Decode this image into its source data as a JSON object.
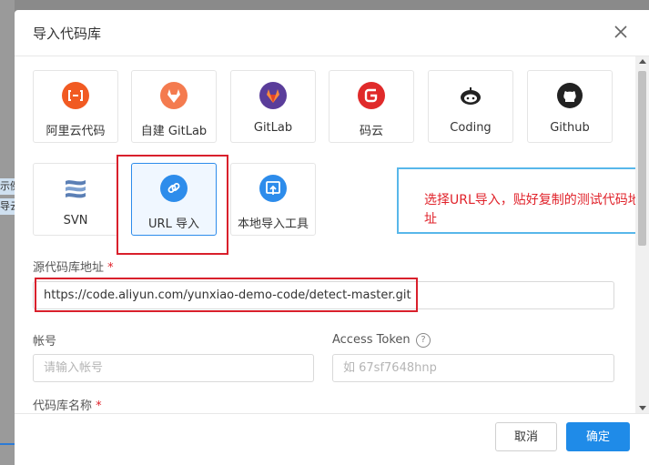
{
  "background": {
    "chip1": "示例",
    "chip2": "导云"
  },
  "dialog": {
    "title": "导入代码库",
    "sources": [
      {
        "label": "阿里云代码",
        "icon": "aliyun-icon",
        "color": "#f15a22"
      },
      {
        "label": "自建 GitLab",
        "icon": "gitlab-icon",
        "color": "#fc6d26"
      },
      {
        "label": "GitLab",
        "icon": "gitlab-icon",
        "color": "#6b4fbb"
      },
      {
        "label": "码云",
        "icon": "gitee-icon",
        "color": "#e02a2a"
      },
      {
        "label": "Coding",
        "icon": "coding-icon",
        "color": "#222222"
      },
      {
        "label": "Github",
        "icon": "github-icon",
        "color": "#222222"
      },
      {
        "label": "SVN",
        "icon": "svn-icon",
        "color": "#5b7fb5"
      },
      {
        "label": "URL 导入",
        "icon": "link-icon",
        "color": "#2d8ceb"
      },
      {
        "label": "本地导入工具",
        "icon": "upload-icon",
        "color": "#2d8ceb"
      }
    ],
    "selected_source": "URL 导入",
    "annotation_note": "选择URL导入，贴好复制的测试代码地址",
    "fields": {
      "repo_url_label": "源代码库地址",
      "repo_url_required": "*",
      "repo_url_value": "https://code.aliyun.com/yunxiao-demo-code/detect-master.git",
      "account_label": "帐号",
      "account_placeholder": "请输入帐号",
      "token_label": "Access Token",
      "token_help": "?",
      "token_placeholder": "如 67sf7648hnp",
      "repo_name_label": "代码库名称",
      "repo_name_required": "*"
    },
    "buttons": {
      "cancel": "取消",
      "confirm": "确定"
    },
    "colors": {
      "primary": "#1f8be8",
      "highlight_red": "#d9202c",
      "note_border": "#58b7ea"
    }
  }
}
